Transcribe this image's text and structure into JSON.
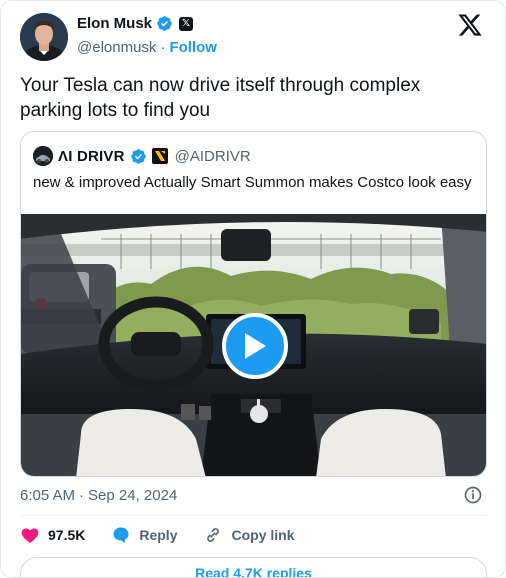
{
  "author": {
    "name": "Elon Musk",
    "handle": "@elonmusk",
    "separator": "·",
    "follow_label": "Follow"
  },
  "tweet": {
    "text": "Your Tesla can now drive itself through complex parking lots to find you"
  },
  "quote": {
    "name": "ΛI DRIVR",
    "handle": "@AIDRIVR",
    "text": "new & improved Actually Smart Summon makes Costco look easy"
  },
  "meta": {
    "time": "6:05 AM",
    "separator": "·",
    "date": "Sep 24, 2024"
  },
  "actions": {
    "likes": "97.5K",
    "reply_label": "Reply",
    "copy_label": "Copy link"
  },
  "replies_button": "Read 4.7K replies",
  "colors": {
    "accent": "#1d9bf0",
    "like": "#f91880",
    "text": "#0f1419",
    "muted": "#536471"
  },
  "icons": [
    "verified-badge-icon",
    "x-affiliate-icon",
    "x-logo-icon",
    "play-icon",
    "info-icon",
    "heart-icon",
    "reply-bubble-icon",
    "link-icon"
  ]
}
